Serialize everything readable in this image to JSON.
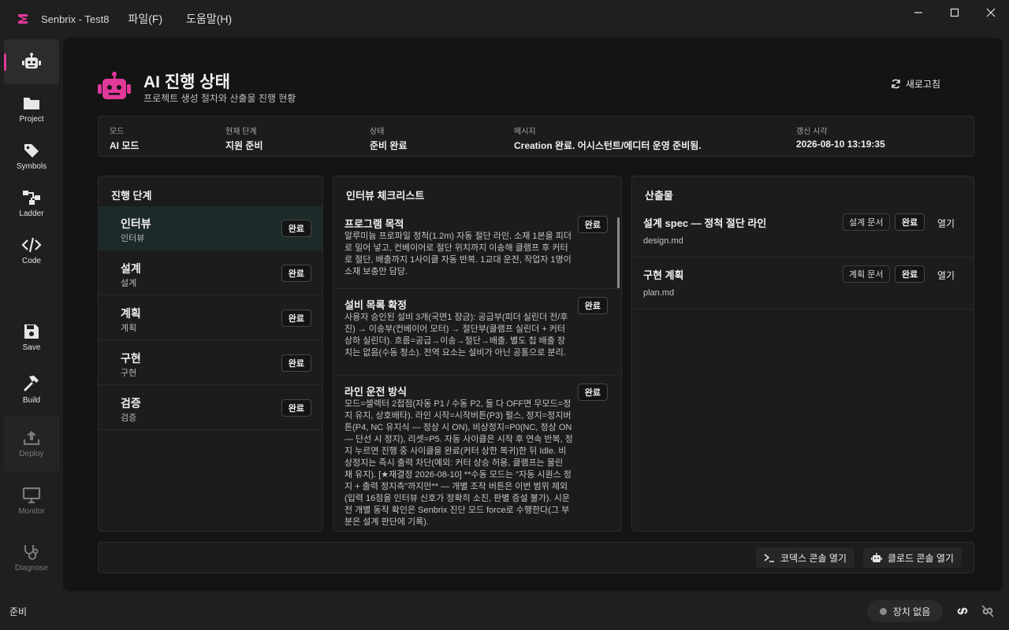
{
  "app": {
    "title": "Senbrix - Test8",
    "menus": [
      "파일(F)",
      "도움말(H)"
    ]
  },
  "colors": {
    "accent": "#e0399a"
  },
  "sidebar": {
    "items": [
      {
        "label": "",
        "icon": "robot-icon"
      },
      {
        "label": "Project",
        "icon": "folder-icon"
      },
      {
        "label": "Symbols",
        "icon": "tag-icon"
      },
      {
        "label": "Ladder",
        "icon": "ladder-icon"
      },
      {
        "label": "Code",
        "icon": "code-icon"
      },
      {
        "label": "Save",
        "icon": "save-icon"
      },
      {
        "label": "Build",
        "icon": "hammer-icon"
      },
      {
        "label": "Deploy",
        "icon": "upload-icon"
      },
      {
        "label": "Monitor",
        "icon": "monitor-icon"
      },
      {
        "label": "Diagnose",
        "icon": "stethoscope-icon"
      }
    ]
  },
  "header": {
    "title": "AI 진행 상태",
    "subtitle": "프로젝트 생성 절차와 산출물 진행 현황",
    "refresh_label": "새로고침"
  },
  "status": [
    {
      "key": "모드",
      "value": "AI 모드"
    },
    {
      "key": "현재 단계",
      "value": "지원 준비"
    },
    {
      "key": "상태",
      "value": "준비 완료"
    },
    {
      "key": "메시지",
      "value": "Creation 완료. 어시스턴트/에디터 운영 준비됨."
    },
    {
      "key": "갱신 시각",
      "value": "2026-08-10 13:19:35"
    }
  ],
  "stages": {
    "title": "진행 단계",
    "items": [
      {
        "name": "인터뷰",
        "sub": "인터뷰",
        "badge": "완료"
      },
      {
        "name": "설계",
        "sub": "설계",
        "badge": "완료"
      },
      {
        "name": "계획",
        "sub": "계획",
        "badge": "완료"
      },
      {
        "name": "구현",
        "sub": "구현",
        "badge": "완료"
      },
      {
        "name": "검증",
        "sub": "검증",
        "badge": "완료"
      }
    ]
  },
  "checklist": {
    "title": "인터뷰 체크리스트",
    "items": [
      {
        "title": "프로그램 목적",
        "badge": "완료",
        "desc": "알루미늄 프로파일 정척(1.2m) 자동 절단 라인. 소재 1본을 피더로 밀어 넣고, 컨베이어로 절단 위치까지 이송해 클램프 후 커터로 절단, 배출까지 1사이클 자동 반복. 1교대 운전, 작업자 1명이 소재 보충만 담당."
      },
      {
        "title": "설비 목록 확정",
        "badge": "완료",
        "desc": "사용자 승인된 설비 3개(국면1 잠금): 공급부(피더 실린더 전/후진) → 이송부(컨베이어 모터) → 절단부(클램프 실린더 + 커터 상하 실린더). 흐름=공급→이송→절단→배출. 별도 칩 배출 장치는 없음(수동 청소). 전역 요소는 설비가 아닌 공통으로 분리."
      },
      {
        "title": "라인 운전 방식",
        "badge": "완료",
        "desc": "모드=셀렉터 2접점(자동 P1 / 수동 P2, 둘 다 OFF면 무모드=정지 유지, 상호배타). 라인 시작=시작버튼(P3) 펄스, 정지=정지버튼(P4, NC 유지식 — 정상 시 ON), 비상정지=P0(NC, 정상 ON — 단선 시 정지), 리셋=P5. 자동 사이클은 시작 후 연속 반복, 정지 누르면 진행 중 사이클을 완료(커터 상한 복귀)한 뒤 Idle. 비상정지는 즉시 출력 차단(예외: 커터 상승 허용, 클램프는 물린 채 유지). [★재결정 2026-08-10] **수동 모드는 \"자동 시퀀스 정지 + 출력 정지측\"까지만** — 개별 조작 버튼은 이번 범위 제외(입력 16점을 인터뷰 신호가 정확히 소진, 판별 증설 불가). 시운전 개별 동작 확인은 Senbrix 진단 모드 force로 수행한다(그 부분은 설계 판단에 기록)."
      }
    ]
  },
  "artifacts": {
    "title": "산출물",
    "items": [
      {
        "title": "설계 spec — 정척 절단 라인",
        "tag": "설계 문서",
        "badge": "완료",
        "open": "열기",
        "file": "design.md"
      },
      {
        "title": "구현 계획",
        "tag": "계획 문서",
        "badge": "완료",
        "open": "열기",
        "file": "plan.md"
      }
    ]
  },
  "footer": {
    "codex_label": "코덱스 콘솔 열기",
    "claude_label": "클로드 콘솔 열기"
  },
  "bottom": {
    "ready": "준비",
    "device": "장치 없음"
  }
}
